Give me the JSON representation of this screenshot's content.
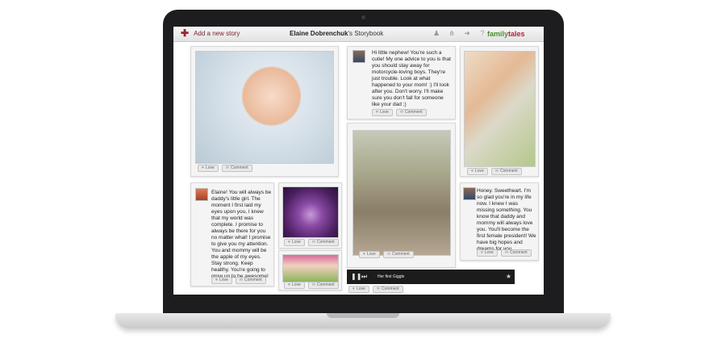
{
  "header": {
    "add_story": "Add a new story",
    "owner_name": "Elaine Dobrenchuk",
    "title_suffix": "'s Storybook",
    "brand_a": "family",
    "brand_b": "tales"
  },
  "actions": {
    "love": "Love",
    "comment": "Comment"
  },
  "messages": {
    "nephew": "Hi little nephew! You're such a cutie! My one advice to you is that you should stay away for motorcycle-loving boys. They're just trouble. Look at what happened to your mom! :) I'll look after you. Don't worry. I'll make sure you don't fall for someone like your dad ;)",
    "elaine": "Elaine! You will always be daddy's little girl. The moment I first laid my eyes upon you, I knew that my world was complete. I promise to always be there for you no matter what! I promise to give you my attention. You and mommy will be the apple of my eyes. Stay strong. Keep healthy. You're going to grow up to be awesome!",
    "honey": "Honey. Sweetheart. I'm so glad you're in my life now. I knew I was missing something. You know that daddy and mommy will always love you. You'll become the first female president! We have big hopes and dreams for you"
  },
  "player": {
    "track": "Her first Giggle"
  },
  "colors": {
    "brand_green": "#4b8e2e",
    "brand_red": "#b0243b",
    "accent": "#9b2335"
  }
}
